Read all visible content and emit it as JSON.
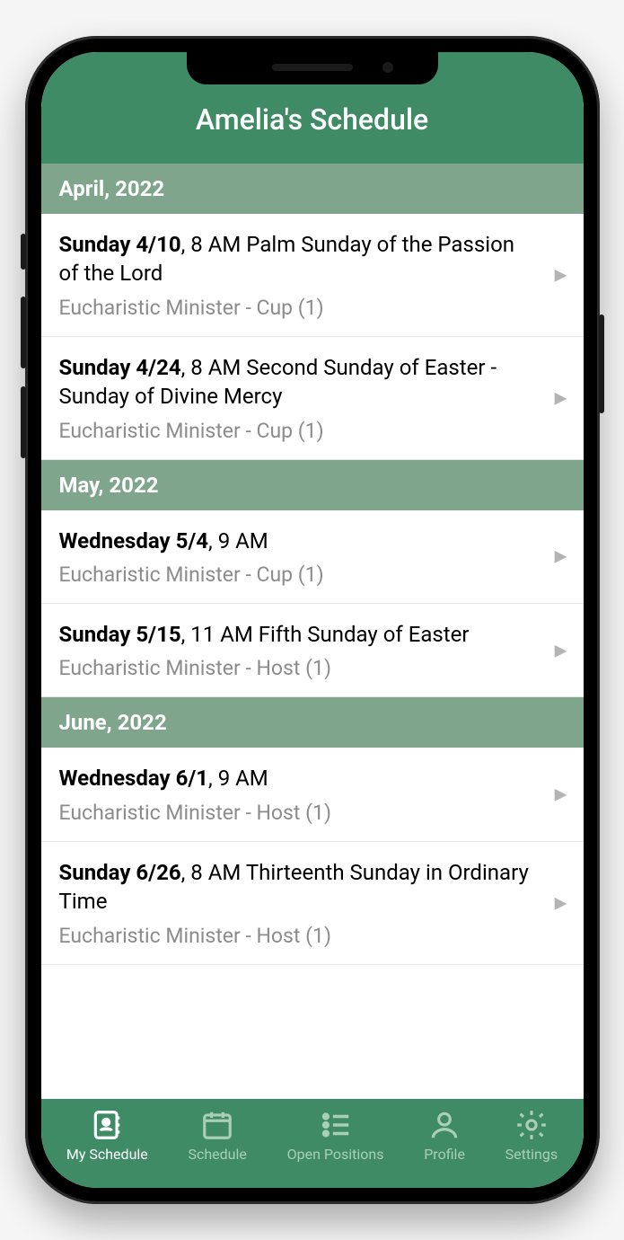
{
  "header": {
    "title": "Amelia's Schedule"
  },
  "sections": [
    {
      "month": "April, 2022",
      "events": [
        {
          "date": "Sunday 4/10",
          "rest": ", 8 AM Palm Sunday of the Passion of the Lord",
          "role": "Eucharistic Minister - Cup (1)"
        },
        {
          "date": "Sunday 4/24",
          "rest": ", 8 AM Second Sunday of Easter - Sunday of Divine Mercy",
          "role": "Eucharistic Minister - Cup (1)"
        }
      ]
    },
    {
      "month": "May, 2022",
      "events": [
        {
          "date": "Wednesday 5/4",
          "rest": ", 9 AM",
          "role": "Eucharistic Minister - Cup (1)"
        },
        {
          "date": "Sunday 5/15",
          "rest": ", 11 AM Fifth Sunday of Easter",
          "role": "Eucharistic Minister - Host (1)"
        }
      ]
    },
    {
      "month": "June, 2022",
      "events": [
        {
          "date": "Wednesday 6/1",
          "rest": ", 9 AM",
          "role": "Eucharistic Minister - Host (1)"
        },
        {
          "date": "Sunday 6/26",
          "rest": ", 8 AM Thirteenth Sunday in Ordinary Time",
          "role": "Eucharistic Minister - Host (1)"
        }
      ]
    }
  ],
  "tabs": {
    "my_schedule": "My Schedule",
    "schedule": "Schedule",
    "open_positions": "Open Positions",
    "profile": "Profile",
    "settings": "Settings"
  }
}
